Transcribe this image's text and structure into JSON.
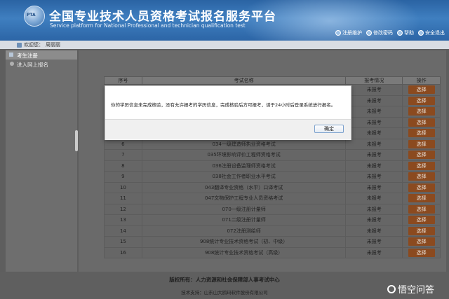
{
  "header": {
    "logo_text": "PTA",
    "title_cn": "全国专业技术人员资格考试报名服务平台",
    "title_en": "Service platform for National Professional and technician qualification test",
    "links": [
      "注册维护",
      "修改密码",
      "帮助",
      "安全退出"
    ]
  },
  "welcome": {
    "text": "欢迎您：",
    "user": "周丽丽"
  },
  "sidebar": {
    "section": "考生注册",
    "items": [
      "进入网上报名"
    ]
  },
  "table": {
    "headers": [
      "序号",
      "考试名称",
      "报考情况",
      "操作"
    ],
    "rows": [
      {
        "num": "",
        "name": "",
        "status": "未报考",
        "op": "选择"
      },
      {
        "num": "",
        "name": "",
        "status": "未报考",
        "op": "选择"
      },
      {
        "num": "",
        "name": "",
        "status": "未报考",
        "op": "选择"
      },
      {
        "num": "",
        "name": "",
        "status": "未报考",
        "op": "选择"
      },
      {
        "num": "",
        "name": "",
        "status": "未报考",
        "op": "选择"
      },
      {
        "num": "6",
        "name": "034一级建造师执业资格考试",
        "status": "未报考",
        "op": "选择"
      },
      {
        "num": "7",
        "name": "035环境影响评价工程师资格考试",
        "status": "未报考",
        "op": "选择"
      },
      {
        "num": "8",
        "name": "036注册设备监理师资格考试",
        "status": "未报考",
        "op": "选择"
      },
      {
        "num": "9",
        "name": "038社会工作者职业水平考试",
        "status": "未报考",
        "op": "选择"
      },
      {
        "num": "10",
        "name": "043翻译专业资格（水平）口译考试",
        "status": "未报考",
        "op": "选择"
      },
      {
        "num": "11",
        "name": "047文物保护工程专业人员资格考试",
        "status": "未报考",
        "op": "选择"
      },
      {
        "num": "12",
        "name": "070一级注册计量师",
        "status": "未报考",
        "op": "选择"
      },
      {
        "num": "13",
        "name": "071二级注册计量师",
        "status": "未报考",
        "op": "选择"
      },
      {
        "num": "14",
        "name": "072注册测绘师",
        "status": "未报考",
        "op": "选择"
      },
      {
        "num": "15",
        "name": "908统计专业技术资格考试（初、中级）",
        "status": "未报考",
        "op": "选择"
      },
      {
        "num": "16",
        "name": "908统计专业技术资格考试（高级）",
        "status": "未报考",
        "op": "选择"
      }
    ]
  },
  "footer": {
    "copyright": "版权所有：人力资源和社会保障部人事考试中心",
    "support": "技术支持：山东山大鸥玛软件股份有限公司"
  },
  "modal": {
    "message": "你的学历信息未完成核验，没有允许报考的学历信息，完成核验后方可报考，请于24小时后登录系统进行报名。",
    "ok_label": "确定"
  },
  "watermark": {
    "text": "悟空问答"
  },
  "colors": {
    "header_blue": "#2a63a3",
    "choose_orange": "#e07b2c"
  }
}
